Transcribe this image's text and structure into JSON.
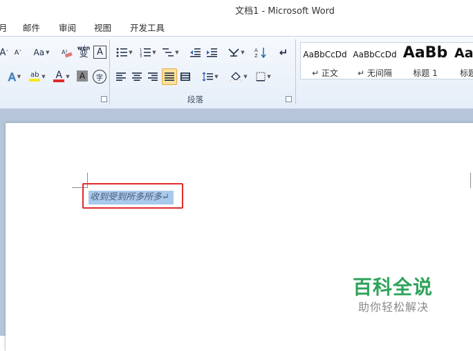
{
  "window": {
    "title": "文档1 - Microsoft Word"
  },
  "menu": {
    "tabs": [
      "月",
      "邮件",
      "审阅",
      "视图",
      "开发工具"
    ]
  },
  "ribbon": {
    "font_group": {
      "grow_label": "A",
      "shrink_label": "A",
      "case_label": "Aa",
      "text_effect_label": "A",
      "highlight_label": "ab",
      "font_color_label": "A",
      "char_shade_label": "A",
      "enclose_label": "字",
      "phonetic_label": "wén",
      "phonetic_char": "变",
      "char_border_label": "A",
      "highlight_color": "#f4e81c",
      "font_color": "#e02a2a"
    },
    "paragraph_group": {
      "label": "段落",
      "show_marks_label": "↵",
      "sort_label": "A↓Z"
    },
    "styles": [
      {
        "sample": "AaBbCcDd",
        "name": "↵ 正文"
      },
      {
        "sample": "AaBbCcDd",
        "name": "↵ 无间隔"
      },
      {
        "sample": "AaBb",
        "name": "标题 1"
      },
      {
        "sample": "AaI",
        "name": "标题"
      }
    ]
  },
  "document": {
    "selected_text": "收到受到所多所多↵"
  },
  "watermark": {
    "title": "百科全说",
    "subtitle": "助你轻松解决"
  }
}
